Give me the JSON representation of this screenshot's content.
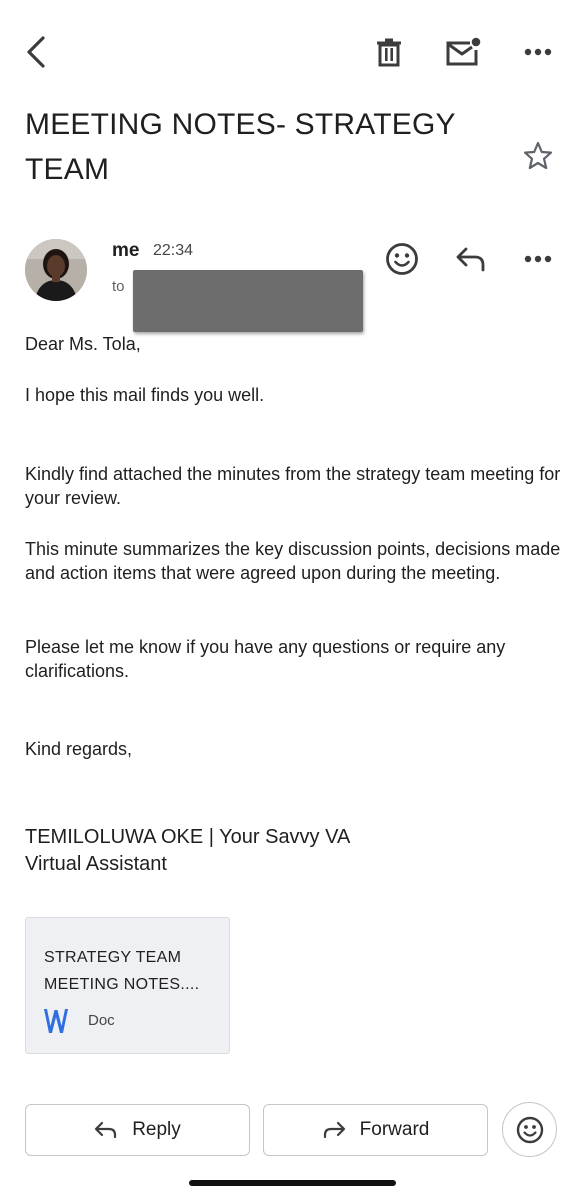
{
  "toolbar": {
    "back_icon": "arrow-back-icon",
    "delete_icon": "trash-icon",
    "mark_unread_icon": "mail-unread-icon",
    "more_icon": "more-horiz-icon"
  },
  "email": {
    "subject": "MEETING NOTES- STRATEGY TEAM",
    "starred": false,
    "sender": {
      "name": "me",
      "time": "22:34",
      "to_label": "to"
    },
    "body": {
      "greeting": "Dear Ms. Tola,",
      "p1": "I hope this mail finds you well.",
      "p2": "Kindly find attached the minutes from the strategy team meeting for your review.",
      "p3": "This minute summarizes the key discussion points, decisions made and action items that were agreed upon during the meeting.",
      "p4": "Please let me know if you have any questions or require any clarifications.",
      "closing": "Kind regards,"
    },
    "signature": {
      "line1": "TEMILOLUWA OKE | Your Savvy VA",
      "line2": "Virtual Assistant"
    },
    "attachment": {
      "title": "STRATEGY TEAM MEETING NOTES....",
      "type": "Doc",
      "icon": "word-doc-icon",
      "icon_color": "#2f6fdf"
    }
  },
  "actions": {
    "reply_label": "Reply",
    "forward_label": "Forward"
  },
  "colors": {
    "text": "#1f1f1f",
    "muted": "#5f6368",
    "border": "#c4c7c5",
    "redaction": "#6d6d6d"
  }
}
